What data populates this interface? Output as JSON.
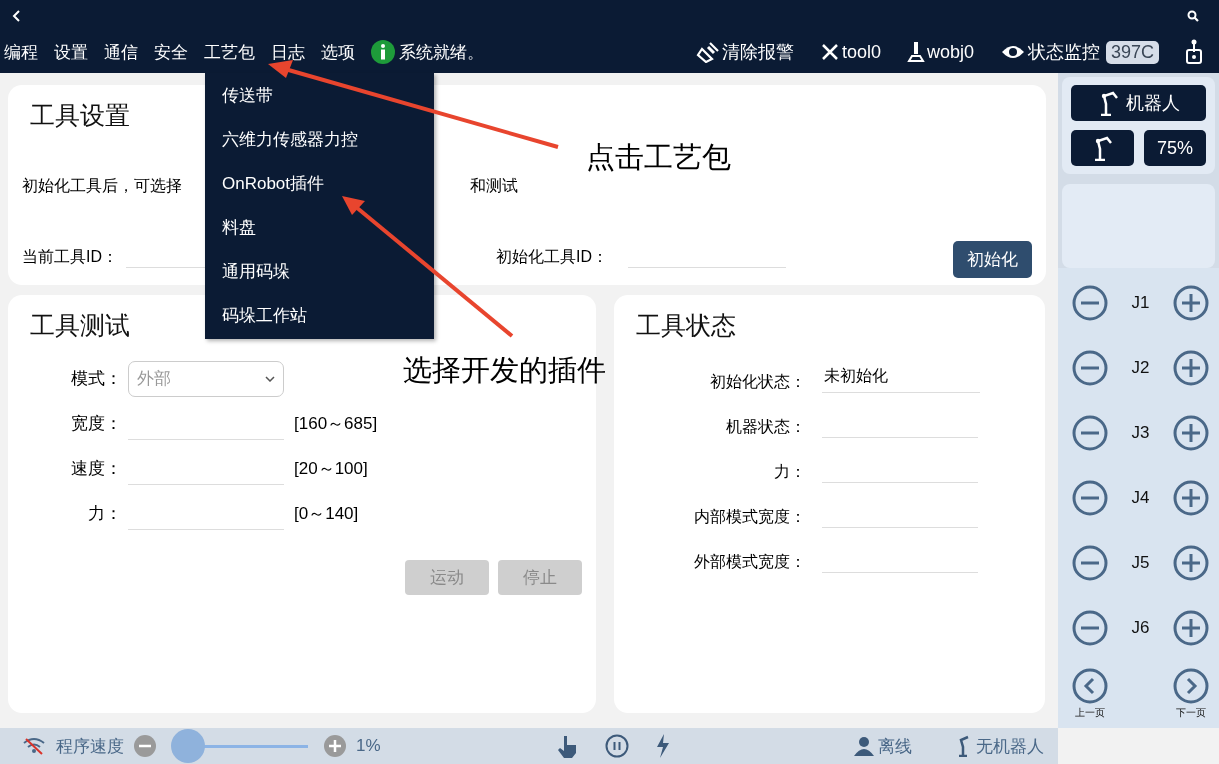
{
  "top_bar": {
    "menu": [
      "编程",
      "设置",
      "通信",
      "安全",
      "工艺包",
      "日志",
      "选项"
    ],
    "status": "系统就绪。",
    "actions": [
      {
        "kind": "clear",
        "label": "清除报警"
      },
      {
        "kind": "tool",
        "label": "tool0"
      },
      {
        "kind": "wobj",
        "label": "wobj0"
      },
      {
        "kind": "monitor",
        "label": "状态监控"
      }
    ],
    "badge": "397C"
  },
  "dropdown": {
    "items": [
      "传送带",
      "六维力传感器力控",
      "OnRobot插件",
      "料盘",
      "通用码垛",
      "码垛工作站"
    ]
  },
  "tool_settings": {
    "title": "工具设置",
    "description_parts": [
      "初始化工具后，可选择",
      "和测试"
    ],
    "current_tool_label": "当前工具ID：",
    "init_tool_label": "初始化工具ID：",
    "init_button": "初始化"
  },
  "tool_test": {
    "title": "工具测试",
    "mode": {
      "label": "模式：",
      "value": "外部"
    },
    "fields": [
      {
        "label": "宽度：",
        "range": "[160～685]"
      },
      {
        "label": "速度：",
        "range": "[20～100]"
      },
      {
        "label": "力：",
        "range": "[0～140]"
      }
    ],
    "buttons": [
      {
        "label": "运动",
        "disabled": true
      },
      {
        "label": "停止",
        "disabled": true
      }
    ]
  },
  "tool_status": {
    "title": "工具状态",
    "fields": [
      {
        "label": "初始化状态：",
        "value": "未初始化"
      },
      {
        "label": "机器状态："
      },
      {
        "label": "力："
      },
      {
        "label": "内部模式宽度："
      },
      {
        "label": "外部模式宽度："
      }
    ]
  },
  "right_panel": {
    "robot_button": "机器人",
    "speed": "75%",
    "joints": [
      "J1",
      "J2",
      "J3",
      "J4",
      "J5",
      "J6"
    ],
    "prev": "上一页",
    "next": "下一页"
  },
  "status_bar": {
    "speed_label": "程序速度",
    "level": 0.01,
    "speed_value": "1%",
    "connection": "离线",
    "robot": "无机器人"
  },
  "annotations": [
    {
      "text": "点击工艺包"
    },
    {
      "text": "选择开发的插件"
    }
  ]
}
